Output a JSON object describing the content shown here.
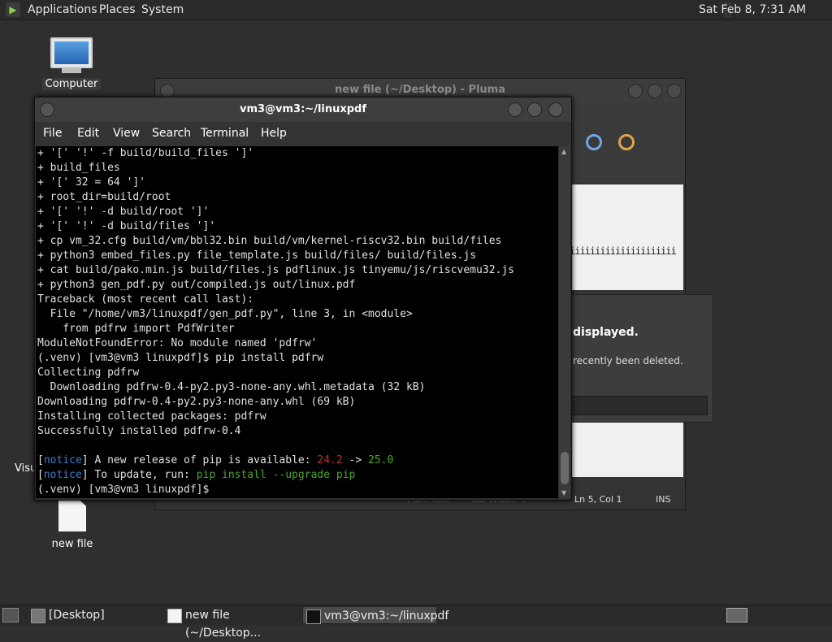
{
  "top_panel": {
    "menus": [
      "Applications",
      "Places",
      "System"
    ],
    "clock": "Sat Feb  8,  7:31 AM"
  },
  "desktop": {
    "icons": [
      "Computer",
      "Visu",
      "new file"
    ]
  },
  "pluma": {
    "title": "new file (~/Desktop) - Pluma",
    "iii_text": "iiiiiiiiiiiiiiiiiiiii",
    "status": {
      "mode": "Plain Text",
      "tab": "Tab Width: 4",
      "position": "Ln 5, Col 1",
      "ins": "INS"
    }
  },
  "dialog": {
    "heading": "displayed.",
    "message": "recently been deleted."
  },
  "terminal": {
    "title": "vm3@vm3:~/linuxpdf",
    "menu": [
      "File",
      "Edit",
      "View",
      "Search",
      "Terminal",
      "Help"
    ],
    "lines": [
      "+ '[' '!' -f build/build_files ']'",
      "+ build_files",
      "+ '[' 32 = 64 ']'",
      "+ root_dir=build/root",
      "+ '[' '!' -d build/root ']'",
      "+ '[' '!' -d build/files ']'",
      "+ cp vm_32.cfg build/vm/bbl32.bin build/vm/kernel-riscv32.bin build/files",
      "+ python3 embed_files.py file_template.js build/files/ build/files.js",
      "+ cat build/pako.min.js build/files.js pdflinux.js tinyemu/js/riscvemu32.js",
      "+ python3 gen_pdf.py out/compiled.js out/linux.pdf",
      "Traceback (most recent call last):",
      "  File \"/home/vm3/linuxpdf/gen_pdf.py\", line 3, in <module>",
      "    from pdfrw import PdfWriter",
      "ModuleNotFoundError: No module named 'pdfrw'",
      "(.venv) [vm3@vm3 linuxpdf]$ pip install pdfrw",
      "Collecting pdfrw",
      "  Downloading pdfrw-0.4-py2.py3-none-any.whl.metadata (32 kB)",
      "Downloading pdfrw-0.4-py2.py3-none-any.whl (69 kB)",
      "Installing collected packages: pdfrw",
      "Successfully installed pdfrw-0.4",
      ""
    ],
    "notice1": {
      "tag": "notice",
      "text": " A new release of pip is available: ",
      "old": "24.2",
      "arrow": " -> ",
      "new": "25.0"
    },
    "notice2": {
      "tag": "notice",
      "text": " To update, run: ",
      "cmd": "pip install --upgrade pip"
    },
    "prompt": "(.venv) [vm3@vm3 linuxpdf]$ "
  },
  "taskbar": {
    "items": [
      "[Desktop]",
      "new file (~/Desktop...",
      "vm3@vm3:~/linuxpdf"
    ]
  }
}
